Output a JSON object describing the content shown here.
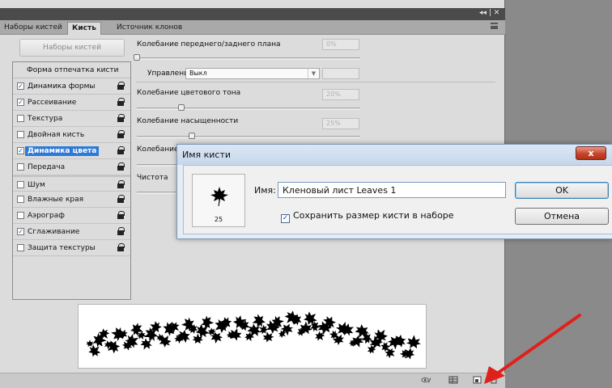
{
  "panel": {
    "topbar_controls": "◂◂ | ✕",
    "tabs": [
      "Наборы кистей",
      "Кисть",
      "Источник клонов"
    ],
    "presets_button": "Наборы кистей",
    "options_header": "Форма отпечатка кисти",
    "options": [
      {
        "label": "Динамика формы",
        "checked": true
      },
      {
        "label": "Рассеивание",
        "checked": true
      },
      {
        "label": "Текстура",
        "checked": false
      },
      {
        "label": "Двойная кисть",
        "checked": false
      },
      {
        "label": "Динамика цвета",
        "checked": true,
        "selected": true
      },
      {
        "label": "Передача",
        "checked": false
      },
      {
        "label": "Шум",
        "checked": false
      },
      {
        "label": "Влажные края",
        "checked": false
      },
      {
        "label": "Аэрограф",
        "checked": false
      },
      {
        "label": "Сглаживание",
        "checked": true
      },
      {
        "label": "Защита текстуры",
        "checked": false
      }
    ],
    "settings": {
      "fg_bg_jitter_label": "Колебание переднего/заднего плана",
      "fg_bg_jitter_value": "0%",
      "control_label": "Управление:",
      "control_value": "Выкл",
      "hue_jitter_label": "Колебание цветового тона",
      "hue_jitter_value": "20%",
      "saturation_jitter_label": "Колебание насыщенности",
      "saturation_jitter_value": "25%",
      "brightness_jitter_label": "Колебание",
      "purity_label": "Чистота"
    }
  },
  "dialog": {
    "title": "Имя кисти",
    "close": "x",
    "brush_size": "25",
    "name_label": "Имя:",
    "name_value": "Кленовый лист Leaves 1",
    "save_size_label": "Сохранить размер кисти в наборе",
    "save_size_checked": true,
    "ok": "OK",
    "cancel": "Отмена"
  },
  "colors": {
    "arrow": "#e0201a",
    "selection": "#2d79d7"
  }
}
